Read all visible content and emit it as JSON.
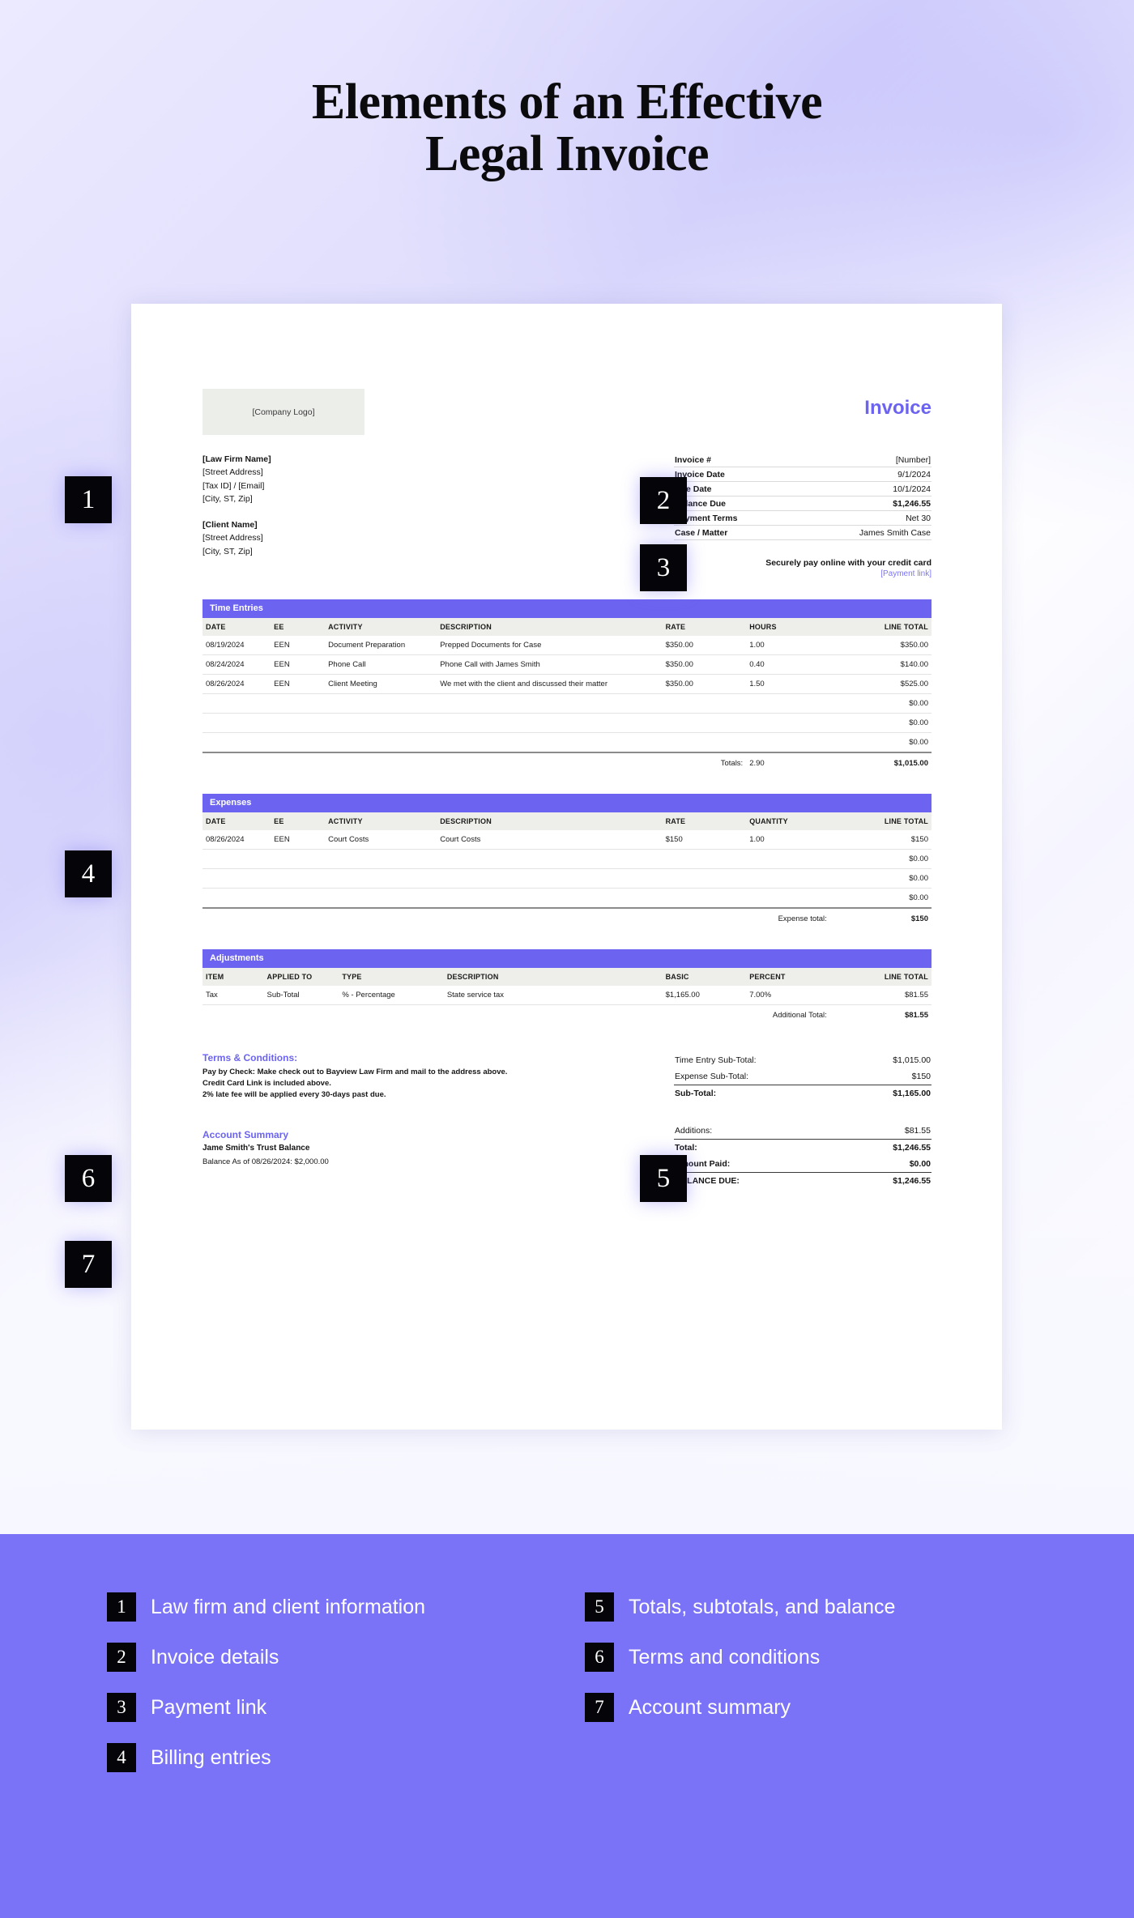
{
  "header": {
    "title_line1": "Elements of an Effective",
    "title_line2": "Legal Invoice"
  },
  "colors": {
    "accent": "#6c64f0",
    "footer_bg": "#7b73f7",
    "badge_bg": "#050509",
    "link": "#7d76f4",
    "table_header_bg": "#eeeeea"
  },
  "invoice": {
    "logo_placeholder": "[Company Logo]",
    "doc_title": "Invoice",
    "law_firm": {
      "name": "[Law Firm Name]",
      "street": "[Street Address]",
      "tax_email": "[Tax ID] / [Email]",
      "city_state_zip": "[City, ST, Zip]"
    },
    "client": {
      "name": "[Client Name]",
      "street": "[Street Address]",
      "city_state_zip": "[City, ST, Zip]"
    },
    "meta": [
      {
        "key": "Invoice #",
        "value": "[Number]",
        "bold": false
      },
      {
        "key": "Invoice Date",
        "value": "9/1/2024",
        "bold": false
      },
      {
        "key": "Due Date",
        "value": "10/1/2024",
        "bold": false
      },
      {
        "key": "Balance Due",
        "value": "$1,246.55",
        "bold": true
      },
      {
        "key": "Payment Terms",
        "value": "Net 30",
        "bold": false
      },
      {
        "key": "Case / Matter",
        "value": "James Smith Case",
        "bold": false
      }
    ],
    "payment": {
      "note": "Securely pay online with your credit card",
      "link_label": "[Payment link]"
    },
    "time_entries": {
      "band_label": "Time Entries",
      "columns": [
        "DATE",
        "EE",
        "ACTIVITY",
        "DESCRIPTION",
        "RATE",
        "HOURS",
        "LINE TOTAL"
      ],
      "rows": [
        {
          "date": "08/19/2024",
          "ee": "EEN",
          "activity": "Document Preparation",
          "description": "Prepped Documents for Case",
          "rate": "$350.00",
          "hours": "1.00",
          "line_total": "$350.00"
        },
        {
          "date": "08/24/2024",
          "ee": "EEN",
          "activity": "Phone Call",
          "description": "Phone Call with James Smith",
          "rate": "$350.00",
          "hours": "0.40",
          "line_total": "$140.00"
        },
        {
          "date": "08/26/2024",
          "ee": "EEN",
          "activity": "Client Meeting",
          "description": "We met with the client and discussed their matter",
          "rate": "$350.00",
          "hours": "1.50",
          "line_total": "$525.00"
        }
      ],
      "empty_rows": [
        "$0.00",
        "$0.00",
        "$0.00"
      ],
      "totals_label": "Totals:",
      "totals_hours": "2.90",
      "totals_amount": "$1,015.00"
    },
    "expenses": {
      "band_label": "Expenses",
      "columns": [
        "DATE",
        "EE",
        "ACTIVITY",
        "DESCRIPTION",
        "RATE",
        "QUANTITY",
        "LINE TOTAL"
      ],
      "rows": [
        {
          "date": "08/26/2024",
          "ee": "EEN",
          "activity": "Court Costs",
          "description": "Court Costs",
          "rate": "$150",
          "quantity": "1.00",
          "line_total": "$150"
        }
      ],
      "empty_rows": [
        "$0.00",
        "$0.00",
        "$0.00"
      ],
      "totals_label": "Expense total:",
      "totals_amount": "$150"
    },
    "adjustments": {
      "band_label": "Adjustments",
      "columns": [
        "ITEM",
        "APPLIED TO",
        "TYPE",
        "DESCRIPTION",
        "BASIC",
        "PERCENT",
        "LINE TOTAL"
      ],
      "rows": [
        {
          "item": "Tax",
          "applied_to": "Sub-Total",
          "type": "% - Percentage",
          "description": "State service tax",
          "basic": "$1,165.00",
          "percent": "7.00%",
          "line_total": "$81.55"
        }
      ],
      "totals_label": "Additional Total:",
      "totals_amount": "$81.55"
    },
    "terms": {
      "heading": "Terms & Conditions:",
      "line1": "Pay by Check: Make check out to Bayview Law Firm and mail to the address above.",
      "line2": "Credit Card Link is included above.",
      "line3": "2% late fee will be applied every 30-days past due."
    },
    "account_summary": {
      "heading": "Account Summary",
      "trust_label": "Jame Smith's Trust Balance",
      "balance_line": "Balance As of 08/26/2024: $2,000.00"
    },
    "summary": [
      {
        "label": "Time Entry Sub-Total:",
        "value": "$1,015.00",
        "bold": false,
        "rule": false
      },
      {
        "label": "Expense Sub-Total:",
        "value": "$150",
        "bold": false,
        "rule": false
      },
      {
        "label": "Sub-Total:",
        "value": "$1,165.00",
        "bold": true,
        "rule": true
      },
      {
        "label": "Additions:",
        "value": "$81.55",
        "bold": false,
        "rule": false
      },
      {
        "label": "Total:",
        "value": "$1,246.55",
        "bold": true,
        "rule": true
      },
      {
        "label": "Amount Paid:",
        "value": "$0.00",
        "bold": true,
        "rule": false
      },
      {
        "label": "BALANCE DUE:",
        "value": "$1,246.55",
        "bold": true,
        "rule": true
      }
    ]
  },
  "callouts": {
    "b1": "1",
    "b2": "2",
    "b3": "3",
    "b4": "4",
    "b5": "5",
    "b6": "6",
    "b7": "7"
  },
  "legend": {
    "left": [
      {
        "num": "1",
        "label": "Law firm and client information"
      },
      {
        "num": "2",
        "label": "Invoice details"
      },
      {
        "num": "3",
        "label": "Payment link"
      },
      {
        "num": "4",
        "label": "Billing entries"
      }
    ],
    "right": [
      {
        "num": "5",
        "label": "Totals, subtotals, and balance"
      },
      {
        "num": "6",
        "label": "Terms and conditions"
      },
      {
        "num": "7",
        "label": "Account summary"
      }
    ]
  }
}
